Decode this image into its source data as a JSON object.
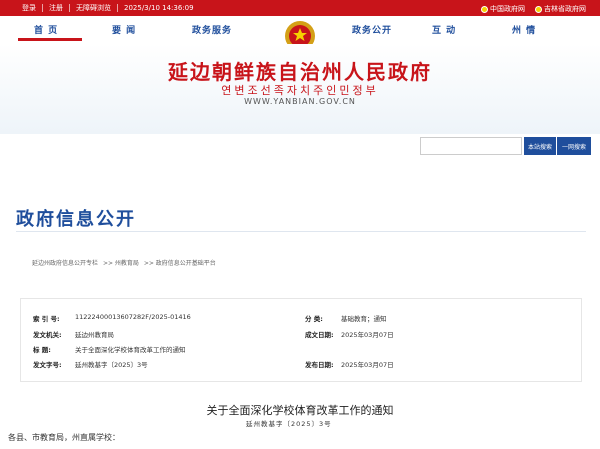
{
  "topbar": {
    "login": "登录",
    "register": "注册",
    "accessible": "无障碍浏览",
    "datetime": "2025/3/10 14:36:09",
    "links": [
      "中国政府网",
      "吉林省政府网"
    ]
  },
  "nav": {
    "items": [
      "首 页",
      "要 闻",
      "政务服务",
      "政务公开",
      "互 动",
      "州 情"
    ],
    "active_color": "#c8141a"
  },
  "banner": {
    "title_cn": "延边朝鲜族自治州人民政府",
    "title_kr": "연변조선족자치주인민정부",
    "url": "WWW.YANBIAN.GOV.CN"
  },
  "search": {
    "placeholder": "",
    "local_label": "本站搜索",
    "global_label": "一网搜索"
  },
  "section": {
    "title": "政府信息公开"
  },
  "breadcrumb": [
    "延边州政府信息公开专栏",
    ">> 州教育局",
    ">> 政府信息公开基础平台"
  ],
  "meta": {
    "rows": [
      {
        "l1": "索 引 号:",
        "v1": "11222400013607282F/2025-01416",
        "l2": "分 类:",
        "v2": "基础教育；通知"
      },
      {
        "l1": "发文机关:",
        "v1": "延边州教育局",
        "l2": "成文日期:",
        "v2": "2025年03月07日"
      },
      {
        "l1": "标 题:",
        "v1": "关于全面深化学校体育改革工作的通知",
        "l2": "",
        "v2": ""
      },
      {
        "l1": "发文字号:",
        "v1": "延州教基字〔2025〕3号",
        "l2": "发布日期:",
        "v2": "2025年03月07日"
      }
    ]
  },
  "document": {
    "title": "关于全面深化学校体育改革工作的通知",
    "number": "延州教基字〔2025〕3号",
    "greeting": "各县、市教育局，州直属学校："
  },
  "colors": {
    "brand_red": "#c8141a",
    "brand_blue": "#1f4e9c"
  }
}
